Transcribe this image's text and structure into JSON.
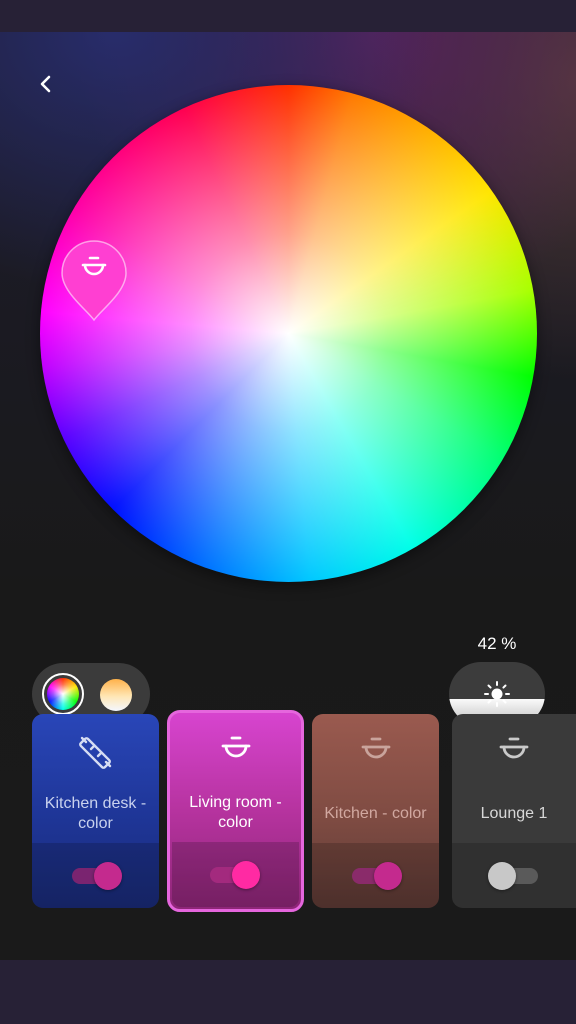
{
  "brightness": {
    "percent_label": "42 %",
    "level": 0.42
  },
  "modes": [
    {
      "name": "color",
      "selected": true
    },
    {
      "name": "white-ambiance",
      "selected": false
    }
  ],
  "picker": {
    "selected_color": "#ff3fd2"
  },
  "lights": [
    {
      "name": "Kitchen desk - color",
      "icon": "lightstrip-icon",
      "on": true,
      "selected": false,
      "tile_color": "#2946b8"
    },
    {
      "name": "Living room - color",
      "icon": "pendant-lamp-icon",
      "on": true,
      "selected": true,
      "tile_color": "#d744cf"
    },
    {
      "name": "Kitchen - color",
      "icon": "pendant-lamp-icon",
      "on": true,
      "selected": false,
      "tile_color": "#9a5a4f"
    },
    {
      "name": "Lounge 1",
      "icon": "pendant-lamp-icon",
      "on": false,
      "selected": false,
      "tile_color": "#3a3a3a"
    }
  ],
  "colors": {
    "accent": "#e91e8c",
    "selection_outline": "#e566dd"
  }
}
